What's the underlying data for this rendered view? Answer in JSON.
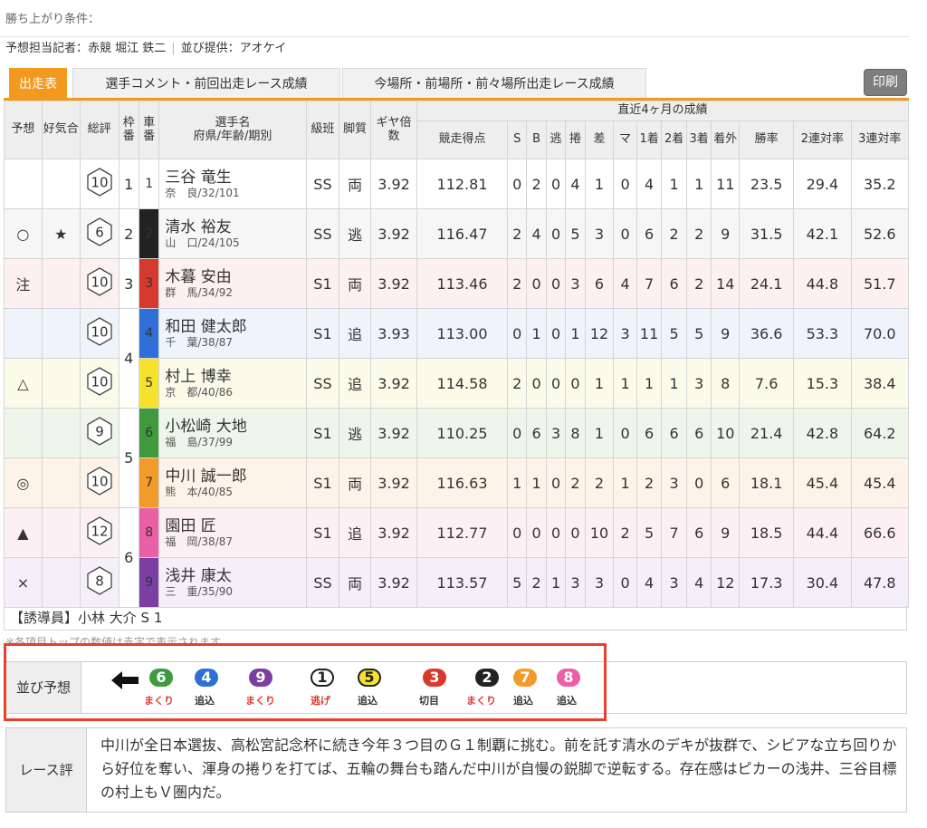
{
  "conditions": {
    "label": "勝ち上がり条件："
  },
  "reporter": {
    "text": "予想担当記者：赤競 堀江 鉄二",
    "provider": "並び提供：アオケイ"
  },
  "tabs": [
    {
      "label": "出走表",
      "active": true
    },
    {
      "label": "選手コメント・前回出走レース成績",
      "active": false
    },
    {
      "label": "今場所・前場所・前々場所出走レース成績",
      "active": false
    }
  ],
  "print_label": "印刷",
  "headers": {
    "yoso": "予想",
    "ninki": "好気合",
    "sohyo": "総評",
    "waku": "枠番",
    "sha": "車番",
    "name": "選手名",
    "name_sub": "府県/年齢/期別",
    "kyu": "級班",
    "kyaku": "脚質",
    "gear": "ギヤ倍数",
    "recent": "直近4ヶ月の成績",
    "score": "競走得点",
    "s": "S",
    "b": "B",
    "nige": "逃",
    "makuri": "捲",
    "sashi": "差",
    "ma": "マ",
    "c1": "1着",
    "c2": "2着",
    "c3": "3着",
    "out": "着外",
    "win": "勝率",
    "ren2": "2連対率",
    "ren3": "3連対率"
  },
  "riders": [
    {
      "mark": "",
      "star": "",
      "hex": "10",
      "waku": "1",
      "car": "1",
      "name": "三谷 竜生",
      "sub": "奈　良/32/101",
      "kyu": "SS",
      "kyaku": "両",
      "gear": "3.92",
      "score": "112.81",
      "s": "0",
      "b": "2",
      "nige": "0",
      "makuri": "4",
      "sashi": "1",
      "ma": "0",
      "c1": "4",
      "c2": "1",
      "c3": "1",
      "out": "11",
      "win": "23.5",
      "ren2": "29.4",
      "ren3": "35.2"
    },
    {
      "mark": "○",
      "star": "★",
      "hex": "6",
      "waku": "2",
      "car": "2",
      "name": "清水 裕友",
      "sub": "山　口/24/105",
      "kyu": "SS",
      "kyaku": "逃",
      "gear": "3.92",
      "score": "116.47",
      "s": "2",
      "b": "4",
      "nige": "0",
      "makuri": "5",
      "sashi": "3",
      "ma": "0",
      "c1": "6",
      "c2": "2",
      "c3": "2",
      "out": "9",
      "win": "31.5",
      "ren2": "42.1",
      "ren3": "52.6"
    },
    {
      "mark": "注",
      "star": "",
      "hex": "10",
      "waku": "3",
      "car": "3",
      "name": "木暮 安由",
      "sub": "群　馬/34/92",
      "kyu": "S1",
      "kyaku": "両",
      "gear": "3.92",
      "score": "113.46",
      "s": "2",
      "b": "0",
      "nige": "0",
      "makuri": "3",
      "sashi": "6",
      "ma": "4",
      "c1": "7",
      "c2": "6",
      "c3": "2",
      "out": "14",
      "win": "24.1",
      "ren2": "44.8",
      "ren3": "51.7"
    },
    {
      "mark": "",
      "star": "",
      "hex": "10",
      "waku": "4",
      "car": "4",
      "name": "和田 健太郎",
      "sub": "千　葉/38/87",
      "kyu": "S1",
      "kyaku": "追",
      "gear": "3.93",
      "score": "113.00",
      "s": "0",
      "b": "1",
      "nige": "0",
      "makuri": "1",
      "sashi": "12",
      "ma": "3",
      "c1": "11",
      "c2": "5",
      "c3": "5",
      "out": "9",
      "win": "36.6",
      "ren2": "53.3",
      "ren3": "70.0"
    },
    {
      "mark": "△",
      "star": "",
      "hex": "10",
      "waku": "",
      "car": "5",
      "name": "村上 博幸",
      "sub": "京　都/40/86",
      "kyu": "SS",
      "kyaku": "追",
      "gear": "3.92",
      "score": "114.58",
      "s": "2",
      "b": "0",
      "nige": "0",
      "makuri": "0",
      "sashi": "1",
      "ma": "1",
      "c1": "1",
      "c2": "1",
      "c3": "3",
      "out": "8",
      "win": "7.6",
      "ren2": "15.3",
      "ren3": "38.4"
    },
    {
      "mark": "",
      "star": "",
      "hex": "9",
      "waku": "5",
      "car": "6",
      "name": "小松崎 大地",
      "sub": "福　島/37/99",
      "kyu": "S1",
      "kyaku": "逃",
      "gear": "3.92",
      "score": "110.25",
      "s": "0",
      "b": "6",
      "nige": "3",
      "makuri": "8",
      "sashi": "1",
      "ma": "0",
      "c1": "6",
      "c2": "6",
      "c3": "6",
      "out": "10",
      "win": "21.4",
      "ren2": "42.8",
      "ren3": "64.2"
    },
    {
      "mark": "◎",
      "star": "",
      "hex": "10",
      "waku": "",
      "car": "7",
      "name": "中川 誠一郎",
      "sub": "熊　本/40/85",
      "kyu": "S1",
      "kyaku": "両",
      "gear": "3.92",
      "score": "116.63",
      "s": "1",
      "b": "1",
      "nige": "0",
      "makuri": "2",
      "sashi": "2",
      "ma": "1",
      "c1": "2",
      "c2": "3",
      "c3": "0",
      "out": "6",
      "win": "18.1",
      "ren2": "45.4",
      "ren3": "45.4"
    },
    {
      "mark": "▲",
      "star": "",
      "hex": "12",
      "waku": "6",
      "car": "8",
      "name": "園田 匠",
      "sub": "福　岡/38/87",
      "kyu": "S1",
      "kyaku": "追",
      "gear": "3.92",
      "score": "112.77",
      "s": "0",
      "b": "0",
      "nige": "0",
      "makuri": "0",
      "sashi": "10",
      "ma": "2",
      "c1": "5",
      "c2": "7",
      "c3": "6",
      "out": "9",
      "win": "18.5",
      "ren2": "44.4",
      "ren3": "66.6"
    },
    {
      "mark": "×",
      "star": "",
      "hex": "8",
      "waku": "",
      "car": "9",
      "name": "浅井 康太",
      "sub": "三　重/35/90",
      "kyu": "SS",
      "kyaku": "両",
      "gear": "3.92",
      "score": "113.57",
      "s": "5",
      "b": "2",
      "nige": "1",
      "makuri": "3",
      "sashi": "3",
      "ma": "0",
      "c1": "4",
      "c2": "3",
      "c3": "4",
      "out": "12",
      "win": "17.3",
      "ren2": "30.4",
      "ren3": "47.8"
    }
  ],
  "guide": "【誘導員】小林 大介 S 1",
  "note": "※各項目トップの数値は赤字で表示されます。",
  "lineup": {
    "label": "並び予想",
    "items": [
      {
        "num": "6",
        "role": "まくり"
      },
      {
        "num": "4",
        "role": "追込"
      },
      {
        "num": "9",
        "role": "まくり"
      },
      {
        "num": "1",
        "role": "逃げ"
      },
      {
        "num": "5",
        "role": "追込"
      },
      {
        "num": "3",
        "role": "切目"
      },
      {
        "num": "2",
        "role": "まくり"
      },
      {
        "num": "7",
        "role": "追込"
      },
      {
        "num": "8",
        "role": "追込"
      }
    ]
  },
  "review": {
    "label": "レース評",
    "text": "中川が全日本選抜、高松宮記念杯に続き今年３つ目のＧ１制覇に挑む。前を託す清水のデキが抜群で、シビアな立ち回りから好位を奪い、渾身の捲りを打てば、五輪の舞台も踏んだ中川が自慢の鋭脚で逆転する。存在感はピカーの浅井、三谷目標の村上もＶ圏内だ。"
  }
}
